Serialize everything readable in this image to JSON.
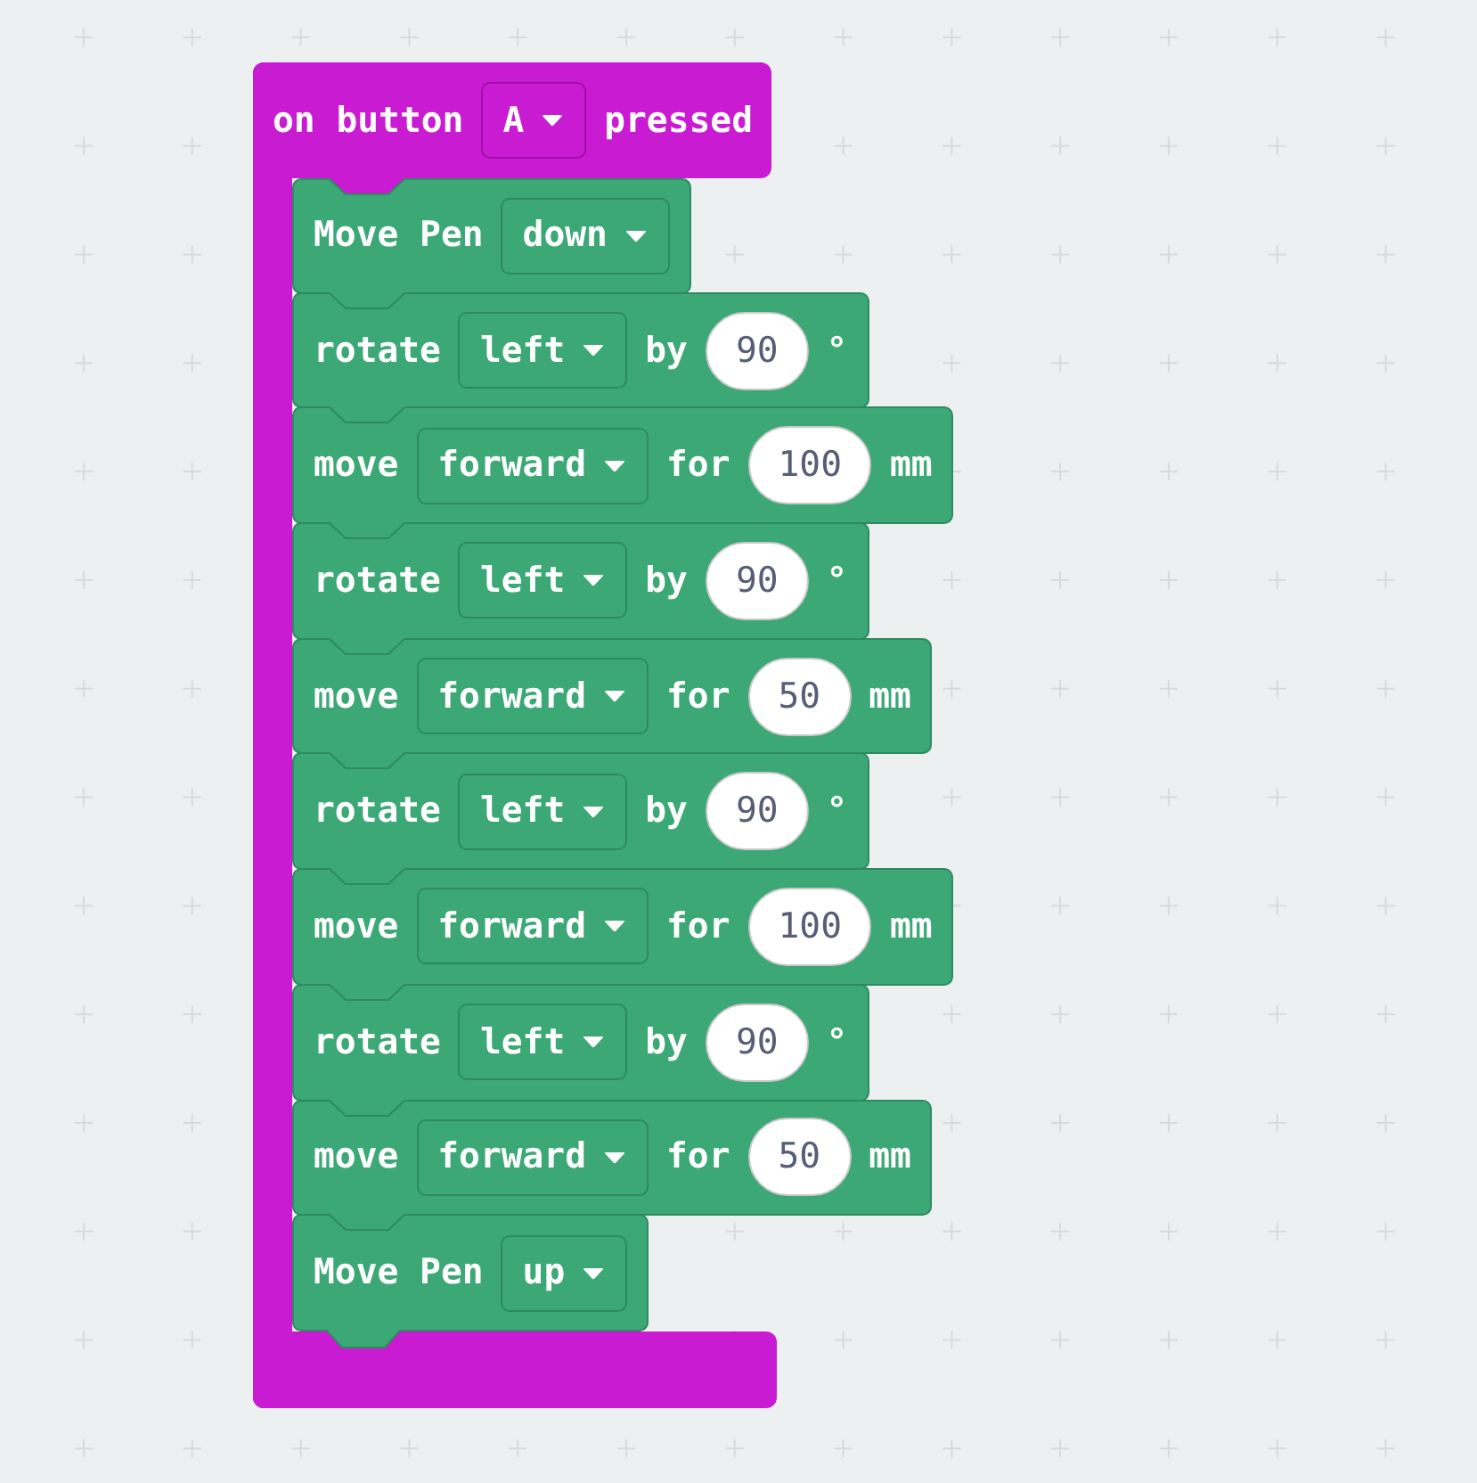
{
  "event_block": {
    "parts": [
      {
        "kind": "text",
        "text": "on button"
      },
      {
        "kind": "dropdown",
        "value": "A"
      },
      {
        "kind": "text",
        "text": "pressed"
      }
    ]
  },
  "blocks": [
    {
      "parts": [
        {
          "kind": "text",
          "text": "Move Pen"
        },
        {
          "kind": "dropdown",
          "value": "down"
        }
      ]
    },
    {
      "parts": [
        {
          "kind": "text",
          "text": "rotate"
        },
        {
          "kind": "dropdown",
          "value": "left"
        },
        {
          "kind": "text",
          "text": "by"
        },
        {
          "kind": "number",
          "value": "90"
        },
        {
          "kind": "text",
          "text": "°"
        }
      ]
    },
    {
      "parts": [
        {
          "kind": "text",
          "text": "move"
        },
        {
          "kind": "dropdown",
          "value": "forward"
        },
        {
          "kind": "text",
          "text": "for"
        },
        {
          "kind": "number",
          "value": "100"
        },
        {
          "kind": "text",
          "text": "mm"
        }
      ]
    },
    {
      "parts": [
        {
          "kind": "text",
          "text": "rotate"
        },
        {
          "kind": "dropdown",
          "value": "left"
        },
        {
          "kind": "text",
          "text": "by"
        },
        {
          "kind": "number",
          "value": "90"
        },
        {
          "kind": "text",
          "text": "°"
        }
      ]
    },
    {
      "parts": [
        {
          "kind": "text",
          "text": "move"
        },
        {
          "kind": "dropdown",
          "value": "forward"
        },
        {
          "kind": "text",
          "text": "for"
        },
        {
          "kind": "number",
          "value": "50"
        },
        {
          "kind": "text",
          "text": "mm"
        }
      ]
    },
    {
      "parts": [
        {
          "kind": "text",
          "text": "rotate"
        },
        {
          "kind": "dropdown",
          "value": "left"
        },
        {
          "kind": "text",
          "text": "by"
        },
        {
          "kind": "number",
          "value": "90"
        },
        {
          "kind": "text",
          "text": "°"
        }
      ]
    },
    {
      "parts": [
        {
          "kind": "text",
          "text": "move"
        },
        {
          "kind": "dropdown",
          "value": "forward"
        },
        {
          "kind": "text",
          "text": "for"
        },
        {
          "kind": "number",
          "value": "100"
        },
        {
          "kind": "text",
          "text": "mm"
        }
      ]
    },
    {
      "parts": [
        {
          "kind": "text",
          "text": "rotate"
        },
        {
          "kind": "dropdown",
          "value": "left"
        },
        {
          "kind": "text",
          "text": "by"
        },
        {
          "kind": "number",
          "value": "90"
        },
        {
          "kind": "text",
          "text": "°"
        }
      ]
    },
    {
      "parts": [
        {
          "kind": "text",
          "text": "move"
        },
        {
          "kind": "dropdown",
          "value": "forward"
        },
        {
          "kind": "text",
          "text": "for"
        },
        {
          "kind": "number",
          "value": "50"
        },
        {
          "kind": "text",
          "text": "mm"
        }
      ]
    },
    {
      "parts": [
        {
          "kind": "text",
          "text": "Move Pen"
        },
        {
          "kind": "dropdown",
          "value": "up"
        }
      ]
    }
  ]
}
